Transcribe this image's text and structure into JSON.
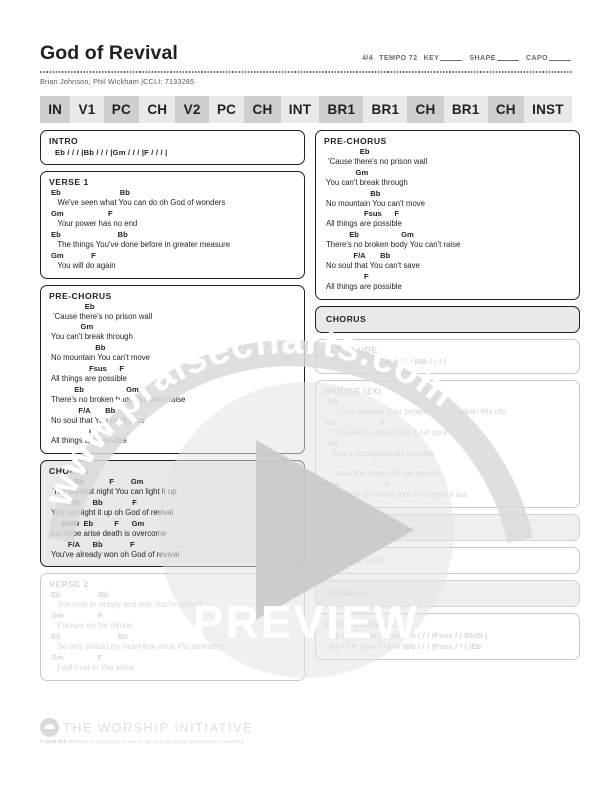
{
  "header": {
    "title": "God of Revival",
    "byline": "Brian Johnson, Phil Wickham  |CCLI: 7133285",
    "time_signature": "4/4",
    "tempo_label": "TEMPO 72",
    "key_label": "KEY",
    "shape_label": "SHAPE",
    "capo_label": "CAPO"
  },
  "order_bar": [
    {
      "label": "IN",
      "shade": "dk"
    },
    {
      "label": "V1",
      "shade": "lt"
    },
    {
      "label": "PC",
      "shade": "dk"
    },
    {
      "label": "CH",
      "shade": "lt"
    },
    {
      "label": "V2",
      "shade": "dk"
    },
    {
      "label": "PC",
      "shade": "lt"
    },
    {
      "label": "CH",
      "shade": "dk"
    },
    {
      "label": "INT",
      "shade": "lt"
    },
    {
      "label": "BR1",
      "shade": "dk"
    },
    {
      "label": "BR1",
      "shade": "lt"
    },
    {
      "label": "CH",
      "shade": "dk"
    },
    {
      "label": "BR1",
      "shade": "lt"
    },
    {
      "label": "CH",
      "shade": "dk"
    },
    {
      "label": "INST",
      "shade": "lt"
    }
  ],
  "left_column": [
    {
      "name": "intro",
      "title": "INTRO",
      "style": "plain",
      "progression": [
        "Eb / / / |Bb / / / |Gm / / / |F / / / |"
      ]
    },
    {
      "name": "verse-1",
      "title": "VERSE 1",
      "style": "plain",
      "lines": [
        {
          "chords": "Eb                            Bb",
          "lyric": "   We've seen what You can do oh God of wonders"
        },
        {
          "chords": "Gm                     F",
          "lyric": "   Your power has no end"
        },
        {
          "chords": "Eb                           Bb",
          "lyric": "   The things You've done before in greater measure"
        },
        {
          "chords": "Gm             F",
          "lyric": "   You will do again"
        }
      ]
    },
    {
      "name": "pre-chorus",
      "title": "PRE-CHORUS",
      "style": "plain",
      "lines": [
        {
          "chords": "                Eb",
          "lyric": " 'Cause there's no prison wall"
        },
        {
          "chords": "              Gm",
          "lyric": "You can't break through"
        },
        {
          "chords": "                     Bb",
          "lyric": "No mountain You can't move"
        },
        {
          "chords": "                  Fsus      F",
          "lyric": "All things are possible"
        },
        {
          "chords": "           Eb                    Gm",
          "lyric": "There's no broken body You can't raise"
        },
        {
          "chords": "             F/A       Bb",
          "lyric": "No soul that You can't save"
        },
        {
          "chords": "                  F",
          "lyric": "All things are possible"
        }
      ]
    },
    {
      "name": "chorus",
      "title": "CHORUS",
      "style": "shaded",
      "lines": [
        {
          "chords": "           Eb            F        Gm",
          "lyric": " The darkest night You can light it up"
        },
        {
          "chords": "        F/A      Bb              F",
          "lyric": "You can light it up oh God of revival"
        },
        {
          "chords": "     Bb/D  Eb          F      Gm",
          "lyric": "Let hope arise death is overcome"
        },
        {
          "chords": "        F/A      Bb             F",
          "lyric": "You've already won oh God of revival"
        }
      ]
    },
    {
      "name": "verse-2",
      "title": "VERSE 2",
      "style": "faded",
      "lines": [
        {
          "chords": "Eb                  Bb",
          "lyric": "   You rose in victory and now You're seated"
        },
        {
          "chords": "Gm                F",
          "lyric": "   Forever on the throne"
        },
        {
          "chords": "Eb                           Bb",
          "lyric": "   So why should my heart fear what You defeated"
        },
        {
          "chords": "Gm                F",
          "lyric": "   I will trust in You alone"
        }
      ]
    }
  ],
  "right_column": [
    {
      "name": "pre-chorus",
      "title": "PRE-CHORUS",
      "style": "plain",
      "lines": [
        {
          "chords": "                Eb",
          "lyric": " 'Cause there's no prison wall"
        },
        {
          "chords": "              Gm",
          "lyric": "You can't break through"
        },
        {
          "chords": "                     Bb",
          "lyric": "No mountain You can't move"
        },
        {
          "chords": "                  Fsus      F",
          "lyric": "All things are possible"
        },
        {
          "chords": "           Eb                    Gm",
          "lyric": "There's no broken body You can't raise"
        },
        {
          "chords": "             F/A       Bb",
          "lyric": "No soul that You can't save"
        },
        {
          "chords": "                  F",
          "lyric": "All things are possible"
        }
      ]
    },
    {
      "name": "chorus",
      "title": "CHORUS",
      "style": "shaded",
      "header_only": true
    },
    {
      "name": "interlude",
      "title": "INTERLUDE",
      "style": "faded",
      "progression": [
        "Bb / / / |Bb / / / |Bb / / / |Bb / / / |"
      ]
    },
    {
      "name": "bridge-2x",
      "title": "BRIDGE (2X)",
      "style": "faded",
      "lines": [
        {
          "chords": " Bb",
          "lyric": "    Come awaken Your people come awaken this city"
        },
        {
          "chords": "Gm                    F",
          "lyric": "   Oh God of revival pour it out pour it out"
        },
        {
          "chords": " Bb",
          "lyric": "   Every stronghold will crumble"
        },
        {
          "chords": "",
          "lyric": "   I hear the chains hit the ground"
        },
        {
          "chords": "Gm                      F",
          "lyric": "   Oh God of revival pour it out pour it out"
        }
      ]
    },
    {
      "name": "chorus",
      "title": "CHORUS",
      "style": "faded-shaded",
      "header_only": true
    },
    {
      "name": "bridge-1x",
      "title": "BRIDGE (1X)",
      "style": "faded",
      "header_only": true
    },
    {
      "name": "chorus",
      "title": "CHORUS",
      "style": "faded-shaded",
      "header_only": true
    },
    {
      "name": "instrumental",
      "title": "INSTRUMENTAL",
      "style": "faded",
      "progression": [
        "Eb / / F  |Gm / / F/A |Bb / / / |Fsus / / Bb/D |",
        "Eb / / F  |Gm / / F/A |Bb / / / |Fsus / / / |Eb"
      ]
    }
  ],
  "footer": {
    "logo_text": "THE WORSHIP INITIATIVE",
    "copyright_prefix": "© 2019 Phil",
    "copyright_rest": " Wickham Music Simply Global Songs Sing My Songs Bethel Music Publishing"
  },
  "watermark": {
    "arc_text": "www.praisecharts.com",
    "preview_text": "PREVIEW"
  }
}
